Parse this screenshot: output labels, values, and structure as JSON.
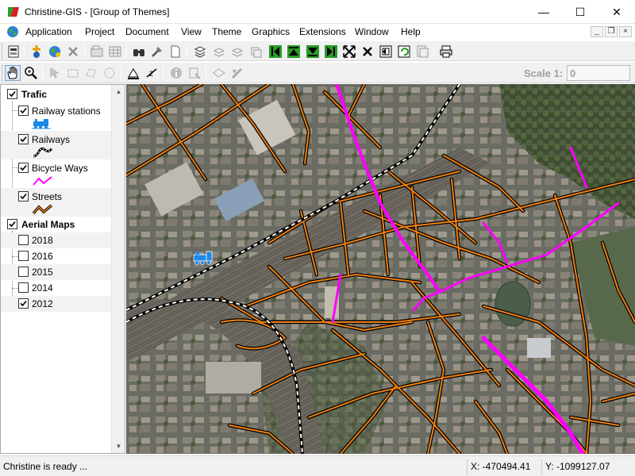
{
  "window": {
    "title": "Christine-GIS - [Group of Themes]",
    "minimize_glyph": "—",
    "maximize_glyph": "☐",
    "close_glyph": "✕"
  },
  "menu": {
    "items": [
      "Application",
      "Project",
      "Document",
      "View",
      "Theme",
      "Graphics",
      "Extensions",
      "Window",
      "Help"
    ],
    "mdi_minimize": "_",
    "mdi_restore": "❐",
    "mdi_close": "×"
  },
  "toolbar": {
    "scale_label": "Scale 1:",
    "scale_value": "0"
  },
  "legend": {
    "groups": [
      {
        "name": "Trafic",
        "checked": true,
        "layers": [
          {
            "name": "Railway stations",
            "checked": true,
            "symbol": "train-icon"
          },
          {
            "name": "Railways",
            "checked": true,
            "symbol": "railway-line-symbol"
          },
          {
            "name": "Bicycle Ways",
            "checked": true,
            "symbol": "bicycle-way-line-symbol"
          },
          {
            "name": "Streets",
            "checked": true,
            "symbol": "street-line-symbol"
          }
        ]
      },
      {
        "name": "Aerial Maps",
        "checked": true,
        "layers": [
          {
            "name": "2018",
            "checked": false
          },
          {
            "name": "2016",
            "checked": false
          },
          {
            "name": "2015",
            "checked": false
          },
          {
            "name": "2014",
            "checked": false
          },
          {
            "name": "2012",
            "checked": true
          }
        ]
      }
    ]
  },
  "colors": {
    "street": "#f08010",
    "street_casing": "#000000",
    "bicycle_way": "#ff00ff",
    "railway": "#ffffff",
    "station": "#1e88e5"
  },
  "status": {
    "message": "Christine is ready ...",
    "x": "X: -470494.41",
    "y": "Y: -1099127.07"
  }
}
